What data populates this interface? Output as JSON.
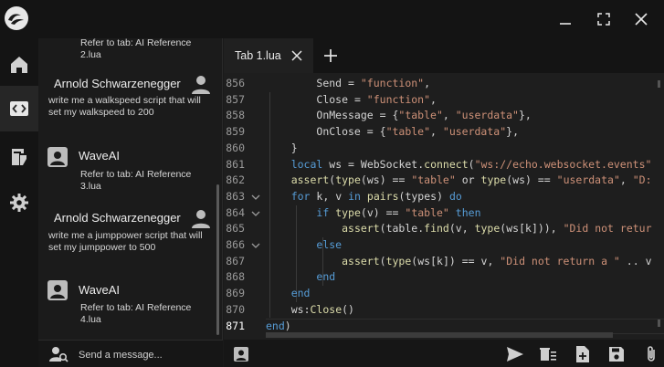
{
  "sidebar": {
    "items": [
      {
        "icon": "home-icon"
      },
      {
        "icon": "code-icon"
      },
      {
        "icon": "script-icon"
      },
      {
        "icon": "gear-icon"
      }
    ]
  },
  "chat": {
    "messages": [
      {
        "text": "Refer to tab: AI Reference 2.lua"
      },
      {
        "name": "Arnold Schwarzenegger",
        "text": "write me a walkspeed script that will set my walkspeed to 200"
      },
      {
        "name": "WaveAI",
        "text": "Refer to tab: AI Reference 3.lua"
      },
      {
        "name": "Arnold Schwarzenegger",
        "text": "write me a jumppower script that will set my jumppower to 500"
      },
      {
        "name": "WaveAI",
        "text": "Refer to tab: AI Reference 4.lua"
      }
    ],
    "input_placeholder": "Send a message..."
  },
  "tabs": [
    {
      "label": "Tab 1.lua"
    }
  ],
  "editor": {
    "line_numbers": [
      "856",
      "857",
      "858",
      "859",
      "860",
      "861",
      "862",
      "863",
      "864",
      "865",
      "866",
      "867",
      "868",
      "869",
      "870",
      "871"
    ],
    "lines": [
      "        Send = \"function\",",
      "        Close = \"function\",",
      "        OnMessage = {\"table\", \"userdata\"},",
      "        OnClose = {\"table\", \"userdata\"},",
      "    }",
      "    local ws = WebSocket.connect(\"ws://echo.websocket.events\"",
      "    assert(type(ws) == \"table\" or type(ws) == \"userdata\", \"D:",
      "    for k, v in pairs(types) do",
      "        if type(v) == \"table\" then",
      "            assert(table.find(v, type(ws[k])), \"Did not retur",
      "        else",
      "            assert(type(ws[k]) == v, \"Did not return a \" .. v",
      "        end",
      "    end",
      "    ws:Close()",
      "end)"
    ]
  },
  "colors": {
    "keyword": "#569cd6",
    "string": "#ce9178",
    "function": "#dcdcaa",
    "background": "#1e1e1e"
  }
}
